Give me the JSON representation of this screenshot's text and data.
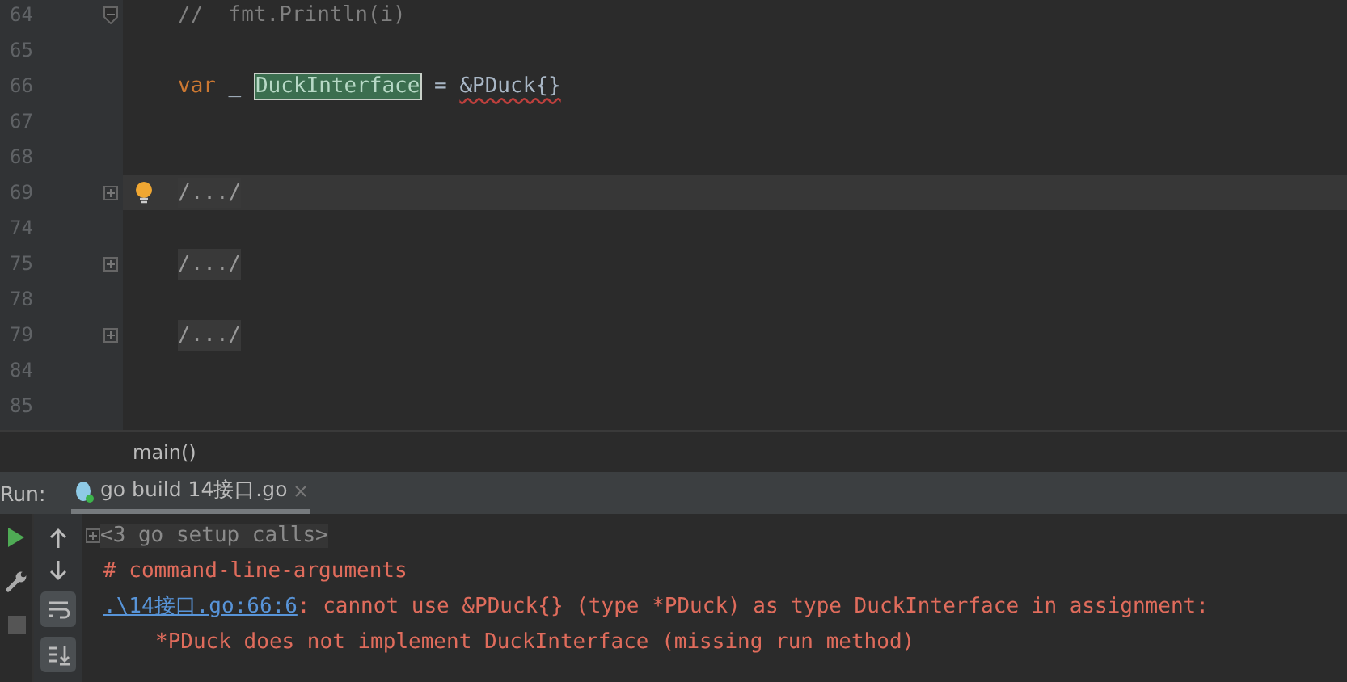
{
  "editor": {
    "lines": [
      {
        "number": "64",
        "kind": "fold_end",
        "bulb": false,
        "current": false,
        "tokens": [
          {
            "kind": "comment",
            "text": "//  fmt.Println(i)"
          }
        ]
      },
      {
        "number": "65",
        "kind": "plain",
        "bulb": false,
        "current": false
      },
      {
        "number": "66",
        "kind": "plain",
        "bulb": false,
        "current": false,
        "tokens": [
          {
            "kind": "keyword",
            "text": "var"
          },
          {
            "kind": "plain",
            "text": " _ "
          },
          {
            "kind": "selected",
            "text": "DuckInterface"
          },
          {
            "kind": "plain",
            "text": " = "
          },
          {
            "kind": "error",
            "text": "&PDuck{}"
          }
        ]
      },
      {
        "number": "67",
        "kind": "plain",
        "bulb": false,
        "current": false
      },
      {
        "number": "68",
        "kind": "plain",
        "bulb": false,
        "current": false
      },
      {
        "number": "69",
        "kind": "collapsed",
        "bulb": true,
        "current": true,
        "tokens": [
          {
            "kind": "folded",
            "text": "/.../"
          }
        ]
      },
      {
        "number": "74",
        "kind": "plain",
        "bulb": false,
        "current": false
      },
      {
        "number": "75",
        "kind": "collapsed",
        "bulb": false,
        "current": false,
        "tokens": [
          {
            "kind": "folded",
            "text": "/.../"
          }
        ]
      },
      {
        "number": "78",
        "kind": "plain",
        "bulb": false,
        "current": false
      },
      {
        "number": "79",
        "kind": "collapsed",
        "bulb": false,
        "current": false,
        "tokens": [
          {
            "kind": "folded",
            "text": "/.../"
          }
        ]
      },
      {
        "number": "84",
        "kind": "plain",
        "bulb": false,
        "current": false
      },
      {
        "number": "85",
        "kind": "plain",
        "bulb": false,
        "current": false
      }
    ],
    "breadcrumb": "main()"
  },
  "run_panel": {
    "label": "Run:",
    "tabs": [
      {
        "label": "go build 14接口.go",
        "selected": true
      }
    ],
    "console": [
      {
        "kind": "folded",
        "parts": [
          {
            "kind": "gray",
            "text": "<3 go setup calls>"
          }
        ]
      },
      {
        "kind": "line",
        "parts": [
          {
            "kind": "error",
            "text": "# command-line-arguments"
          }
        ]
      },
      {
        "kind": "line",
        "parts": [
          {
            "kind": "link",
            "text": ".\\14接口.go:66:6"
          },
          {
            "kind": "error",
            "text": ": cannot use &PDuck{} (type *PDuck) as type DuckInterface in assignment:"
          }
        ]
      },
      {
        "kind": "indented",
        "parts": [
          {
            "kind": "error",
            "text": "*PDuck does not implement DuckInterface (missing run method)"
          }
        ]
      }
    ]
  }
}
